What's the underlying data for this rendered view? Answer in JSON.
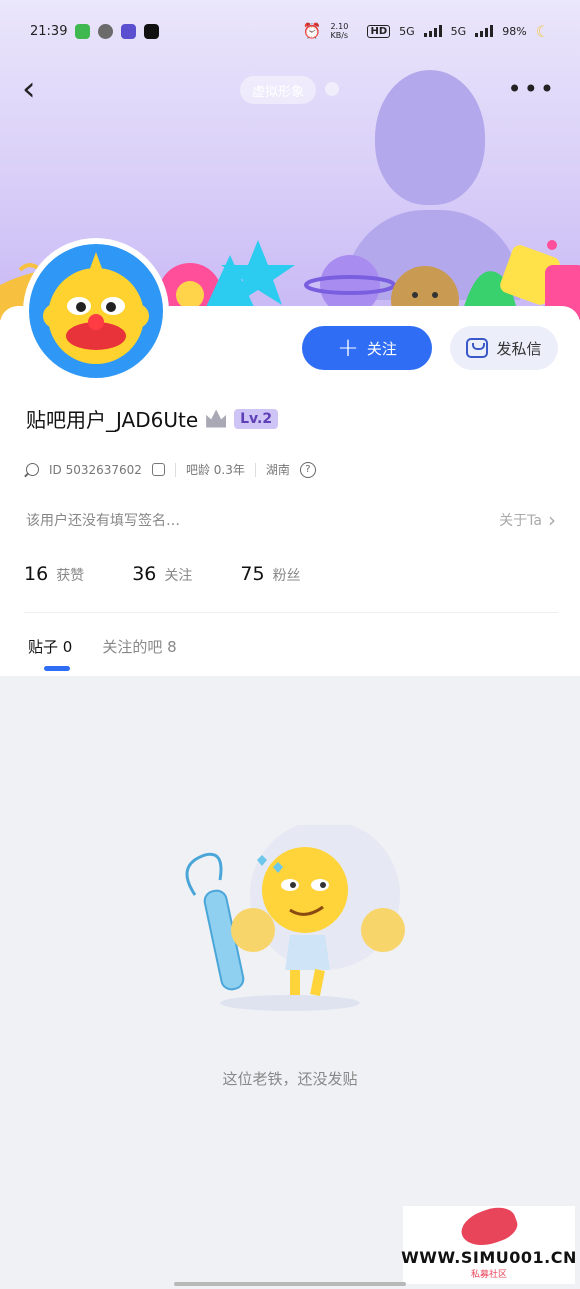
{
  "status_bar": {
    "time": "21:39",
    "net_speed": "2.10 KB/s",
    "hd": "HD",
    "sim1": "5G",
    "sim2": "5G",
    "battery": "98%"
  },
  "header": {
    "virtual_avatar_label": "虚拟形象"
  },
  "actions": {
    "follow_label": "关注",
    "message_label": "发私信"
  },
  "profile": {
    "username": "贴吧用户_JAD6Ute",
    "level": "Lv.2",
    "id_text": "ID 5032637602",
    "bar_age": "吧龄 0.3年",
    "location": "湖南",
    "bio": "该用户还没有填写签名…",
    "about_label": "关于Ta"
  },
  "stats": [
    {
      "value": "16",
      "label": "获赞"
    },
    {
      "value": "36",
      "label": "关注"
    },
    {
      "value": "75",
      "label": "粉丝"
    }
  ],
  "tabs": [
    {
      "label": "贴子 0"
    },
    {
      "label": "关注的吧 8"
    }
  ],
  "empty_state": {
    "message": "这位老铁，还没发贴"
  },
  "watermark": {
    "site": "WWW.SIMU001.CN",
    "sub": "私募社区"
  },
  "colors": {
    "accent": "#2f6ef4",
    "header_top": "#eae6fb",
    "header_bottom": "#c8b8f5",
    "level_bg": "#cfc4f6"
  }
}
